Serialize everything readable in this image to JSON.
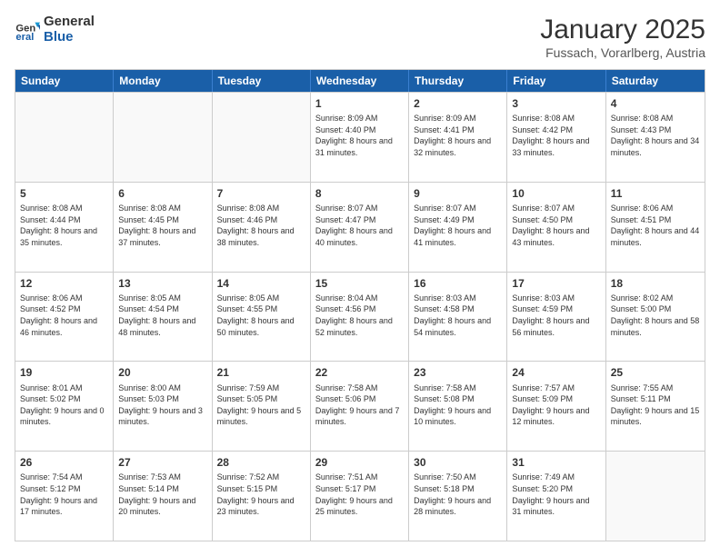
{
  "header": {
    "logo_general": "General",
    "logo_blue": "Blue",
    "title": "January 2025",
    "subtitle": "Fussach, Vorarlberg, Austria"
  },
  "days_of_week": [
    "Sunday",
    "Monday",
    "Tuesday",
    "Wednesday",
    "Thursday",
    "Friday",
    "Saturday"
  ],
  "weeks": [
    [
      {
        "day": "",
        "content": ""
      },
      {
        "day": "",
        "content": ""
      },
      {
        "day": "",
        "content": ""
      },
      {
        "day": "1",
        "content": "Sunrise: 8:09 AM\nSunset: 4:40 PM\nDaylight: 8 hours and 31 minutes."
      },
      {
        "day": "2",
        "content": "Sunrise: 8:09 AM\nSunset: 4:41 PM\nDaylight: 8 hours and 32 minutes."
      },
      {
        "day": "3",
        "content": "Sunrise: 8:08 AM\nSunset: 4:42 PM\nDaylight: 8 hours and 33 minutes."
      },
      {
        "day": "4",
        "content": "Sunrise: 8:08 AM\nSunset: 4:43 PM\nDaylight: 8 hours and 34 minutes."
      }
    ],
    [
      {
        "day": "5",
        "content": "Sunrise: 8:08 AM\nSunset: 4:44 PM\nDaylight: 8 hours and 35 minutes."
      },
      {
        "day": "6",
        "content": "Sunrise: 8:08 AM\nSunset: 4:45 PM\nDaylight: 8 hours and 37 minutes."
      },
      {
        "day": "7",
        "content": "Sunrise: 8:08 AM\nSunset: 4:46 PM\nDaylight: 8 hours and 38 minutes."
      },
      {
        "day": "8",
        "content": "Sunrise: 8:07 AM\nSunset: 4:47 PM\nDaylight: 8 hours and 40 minutes."
      },
      {
        "day": "9",
        "content": "Sunrise: 8:07 AM\nSunset: 4:49 PM\nDaylight: 8 hours and 41 minutes."
      },
      {
        "day": "10",
        "content": "Sunrise: 8:07 AM\nSunset: 4:50 PM\nDaylight: 8 hours and 43 minutes."
      },
      {
        "day": "11",
        "content": "Sunrise: 8:06 AM\nSunset: 4:51 PM\nDaylight: 8 hours and 44 minutes."
      }
    ],
    [
      {
        "day": "12",
        "content": "Sunrise: 8:06 AM\nSunset: 4:52 PM\nDaylight: 8 hours and 46 minutes."
      },
      {
        "day": "13",
        "content": "Sunrise: 8:05 AM\nSunset: 4:54 PM\nDaylight: 8 hours and 48 minutes."
      },
      {
        "day": "14",
        "content": "Sunrise: 8:05 AM\nSunset: 4:55 PM\nDaylight: 8 hours and 50 minutes."
      },
      {
        "day": "15",
        "content": "Sunrise: 8:04 AM\nSunset: 4:56 PM\nDaylight: 8 hours and 52 minutes."
      },
      {
        "day": "16",
        "content": "Sunrise: 8:03 AM\nSunset: 4:58 PM\nDaylight: 8 hours and 54 minutes."
      },
      {
        "day": "17",
        "content": "Sunrise: 8:03 AM\nSunset: 4:59 PM\nDaylight: 8 hours and 56 minutes."
      },
      {
        "day": "18",
        "content": "Sunrise: 8:02 AM\nSunset: 5:00 PM\nDaylight: 8 hours and 58 minutes."
      }
    ],
    [
      {
        "day": "19",
        "content": "Sunrise: 8:01 AM\nSunset: 5:02 PM\nDaylight: 9 hours and 0 minutes."
      },
      {
        "day": "20",
        "content": "Sunrise: 8:00 AM\nSunset: 5:03 PM\nDaylight: 9 hours and 3 minutes."
      },
      {
        "day": "21",
        "content": "Sunrise: 7:59 AM\nSunset: 5:05 PM\nDaylight: 9 hours and 5 minutes."
      },
      {
        "day": "22",
        "content": "Sunrise: 7:58 AM\nSunset: 5:06 PM\nDaylight: 9 hours and 7 minutes."
      },
      {
        "day": "23",
        "content": "Sunrise: 7:58 AM\nSunset: 5:08 PM\nDaylight: 9 hours and 10 minutes."
      },
      {
        "day": "24",
        "content": "Sunrise: 7:57 AM\nSunset: 5:09 PM\nDaylight: 9 hours and 12 minutes."
      },
      {
        "day": "25",
        "content": "Sunrise: 7:55 AM\nSunset: 5:11 PM\nDaylight: 9 hours and 15 minutes."
      }
    ],
    [
      {
        "day": "26",
        "content": "Sunrise: 7:54 AM\nSunset: 5:12 PM\nDaylight: 9 hours and 17 minutes."
      },
      {
        "day": "27",
        "content": "Sunrise: 7:53 AM\nSunset: 5:14 PM\nDaylight: 9 hours and 20 minutes."
      },
      {
        "day": "28",
        "content": "Sunrise: 7:52 AM\nSunset: 5:15 PM\nDaylight: 9 hours and 23 minutes."
      },
      {
        "day": "29",
        "content": "Sunrise: 7:51 AM\nSunset: 5:17 PM\nDaylight: 9 hours and 25 minutes."
      },
      {
        "day": "30",
        "content": "Sunrise: 7:50 AM\nSunset: 5:18 PM\nDaylight: 9 hours and 28 minutes."
      },
      {
        "day": "31",
        "content": "Sunrise: 7:49 AM\nSunset: 5:20 PM\nDaylight: 9 hours and 31 minutes."
      },
      {
        "day": "",
        "content": ""
      }
    ]
  ]
}
